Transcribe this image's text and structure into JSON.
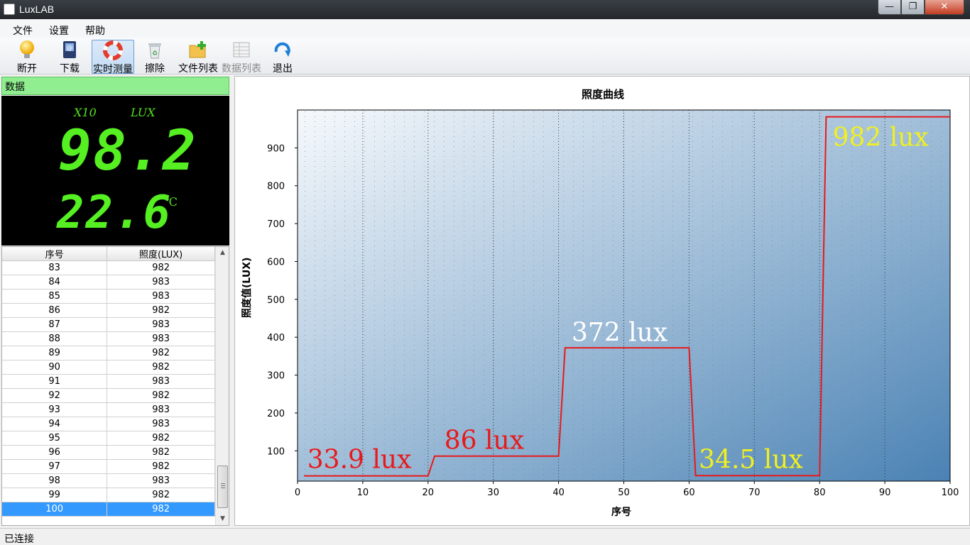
{
  "window": {
    "title": "LuxLAB",
    "minimize": "—",
    "maximize": "❐",
    "close": "✕"
  },
  "menu": {
    "items": [
      "文件",
      "设置",
      "帮助"
    ]
  },
  "toolbar": {
    "disconnect": "断开",
    "download": "下载",
    "realtime": "实时测量",
    "erase": "擦除",
    "file_list": "文件列表",
    "data_list": "数据列表",
    "exit": "退出"
  },
  "left_panel": {
    "header": "数据",
    "lcd": {
      "multiplier": "X10",
      "unit": "LUX",
      "illuminance": "98.2",
      "temperature": "22.6",
      "temp_unit": "℃"
    },
    "table": {
      "columns": [
        "序号",
        "照度(LUX)"
      ],
      "rows": [
        [
          "83",
          "982"
        ],
        [
          "84",
          "983"
        ],
        [
          "85",
          "983"
        ],
        [
          "86",
          "982"
        ],
        [
          "87",
          "983"
        ],
        [
          "88",
          "983"
        ],
        [
          "89",
          "982"
        ],
        [
          "90",
          "982"
        ],
        [
          "91",
          "983"
        ],
        [
          "92",
          "982"
        ],
        [
          "93",
          "983"
        ],
        [
          "94",
          "983"
        ],
        [
          "95",
          "982"
        ],
        [
          "96",
          "982"
        ],
        [
          "97",
          "982"
        ],
        [
          "98",
          "983"
        ],
        [
          "99",
          "982"
        ],
        [
          "100",
          "982"
        ]
      ],
      "selected_row": 17
    }
  },
  "chart_data": {
    "type": "line",
    "title": "照度曲线",
    "xlabel": "序号",
    "ylabel": "照度值(LUX)",
    "xlim": [
      0,
      100
    ],
    "ylim": [
      20,
      1000
    ],
    "xticks": [
      0,
      10,
      20,
      30,
      40,
      50,
      60,
      70,
      80,
      90,
      100
    ],
    "yticks": [
      100,
      200,
      300,
      400,
      500,
      600,
      700,
      800,
      900
    ],
    "grid": true,
    "line_color": "#e8191b",
    "series": [
      {
        "x": [
          1,
          20,
          21,
          40,
          41,
          60,
          61,
          80,
          81,
          100
        ],
        "y": [
          33.9,
          33.9,
          86,
          86,
          372,
          372,
          34.5,
          34.5,
          982,
          982
        ]
      }
    ],
    "annotations": [
      {
        "text": "33.9 lux",
        "x": 1.5,
        "y": 55,
        "color": "#e8191b"
      },
      {
        "text": "86 lux",
        "x": 22.5,
        "y": 105,
        "color": "#e8191b"
      },
      {
        "text": "372 lux",
        "x": 42,
        "y": 390,
        "color": "#ffffff"
      },
      {
        "text": "34.5 lux",
        "x": 61.5,
        "y": 55,
        "color": "#f0f020"
      },
      {
        "text": "982 lux",
        "x": 82,
        "y": 905,
        "color": "#f0f020"
      }
    ]
  },
  "status": {
    "text": "已连接"
  }
}
